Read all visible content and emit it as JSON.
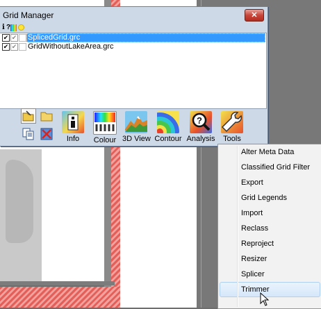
{
  "window": {
    "title": "Grid Manager",
    "close_label": "✕",
    "mini_toolbar": {
      "info_glyph": "i",
      "query_glyph": "?"
    }
  },
  "grids": [
    {
      "name": "SplicedGrid.grc",
      "checked": "✔",
      "selected": true
    },
    {
      "name": "GridWithoutLakeArea.grc",
      "checked": "✔",
      "selected": false
    }
  ],
  "toolbar": {
    "info": "Info",
    "colour": "Colour",
    "view3d": "3D View",
    "contour": "Contour",
    "analysis": "Analysis",
    "tools": "Tools"
  },
  "tools_menu": {
    "items": [
      "Alter Meta Data",
      "Classified Grid Filter",
      "Export",
      "Grid Legends",
      "Import",
      "Reclass",
      "Reproject",
      "Resizer",
      "Splicer",
      "Trimmer"
    ],
    "hovered": "Trimmer"
  },
  "colors": {
    "selection": "#3399ff",
    "window_bg": "#ced9e7",
    "hatch_red": "#e3605a"
  }
}
